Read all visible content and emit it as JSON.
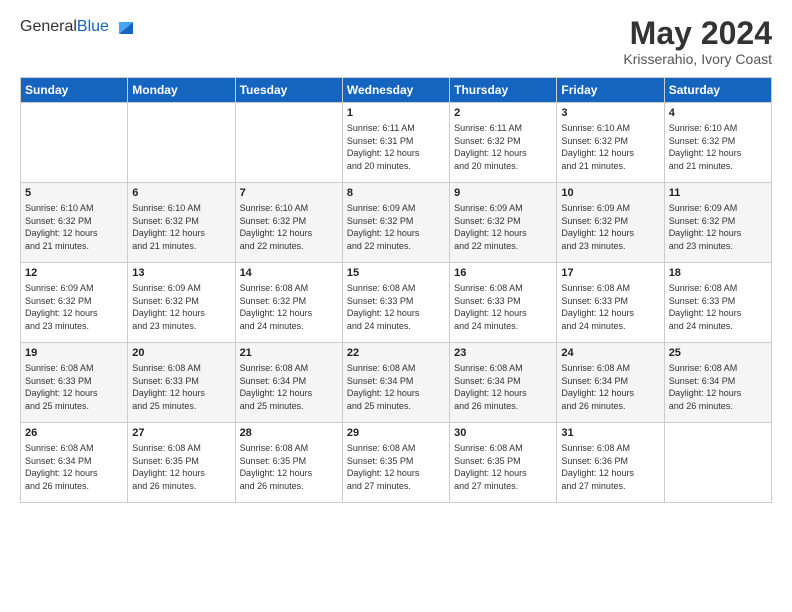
{
  "header": {
    "logo_general": "General",
    "logo_blue": "Blue",
    "month_year": "May 2024",
    "location": "Krisserahio, Ivory Coast"
  },
  "weekdays": [
    "Sunday",
    "Monday",
    "Tuesday",
    "Wednesday",
    "Thursday",
    "Friday",
    "Saturday"
  ],
  "weeks": [
    [
      {
        "day": "",
        "info": ""
      },
      {
        "day": "",
        "info": ""
      },
      {
        "day": "",
        "info": ""
      },
      {
        "day": "1",
        "info": "Sunrise: 6:11 AM\nSunset: 6:31 PM\nDaylight: 12 hours\nand 20 minutes."
      },
      {
        "day": "2",
        "info": "Sunrise: 6:11 AM\nSunset: 6:32 PM\nDaylight: 12 hours\nand 20 minutes."
      },
      {
        "day": "3",
        "info": "Sunrise: 6:10 AM\nSunset: 6:32 PM\nDaylight: 12 hours\nand 21 minutes."
      },
      {
        "day": "4",
        "info": "Sunrise: 6:10 AM\nSunset: 6:32 PM\nDaylight: 12 hours\nand 21 minutes."
      }
    ],
    [
      {
        "day": "5",
        "info": "Sunrise: 6:10 AM\nSunset: 6:32 PM\nDaylight: 12 hours\nand 21 minutes."
      },
      {
        "day": "6",
        "info": "Sunrise: 6:10 AM\nSunset: 6:32 PM\nDaylight: 12 hours\nand 21 minutes."
      },
      {
        "day": "7",
        "info": "Sunrise: 6:10 AM\nSunset: 6:32 PM\nDaylight: 12 hours\nand 22 minutes."
      },
      {
        "day": "8",
        "info": "Sunrise: 6:09 AM\nSunset: 6:32 PM\nDaylight: 12 hours\nand 22 minutes."
      },
      {
        "day": "9",
        "info": "Sunrise: 6:09 AM\nSunset: 6:32 PM\nDaylight: 12 hours\nand 22 minutes."
      },
      {
        "day": "10",
        "info": "Sunrise: 6:09 AM\nSunset: 6:32 PM\nDaylight: 12 hours\nand 23 minutes."
      },
      {
        "day": "11",
        "info": "Sunrise: 6:09 AM\nSunset: 6:32 PM\nDaylight: 12 hours\nand 23 minutes."
      }
    ],
    [
      {
        "day": "12",
        "info": "Sunrise: 6:09 AM\nSunset: 6:32 PM\nDaylight: 12 hours\nand 23 minutes."
      },
      {
        "day": "13",
        "info": "Sunrise: 6:09 AM\nSunset: 6:32 PM\nDaylight: 12 hours\nand 23 minutes."
      },
      {
        "day": "14",
        "info": "Sunrise: 6:08 AM\nSunset: 6:32 PM\nDaylight: 12 hours\nand 24 minutes."
      },
      {
        "day": "15",
        "info": "Sunrise: 6:08 AM\nSunset: 6:33 PM\nDaylight: 12 hours\nand 24 minutes."
      },
      {
        "day": "16",
        "info": "Sunrise: 6:08 AM\nSunset: 6:33 PM\nDaylight: 12 hours\nand 24 minutes."
      },
      {
        "day": "17",
        "info": "Sunrise: 6:08 AM\nSunset: 6:33 PM\nDaylight: 12 hours\nand 24 minutes."
      },
      {
        "day": "18",
        "info": "Sunrise: 6:08 AM\nSunset: 6:33 PM\nDaylight: 12 hours\nand 24 minutes."
      }
    ],
    [
      {
        "day": "19",
        "info": "Sunrise: 6:08 AM\nSunset: 6:33 PM\nDaylight: 12 hours\nand 25 minutes."
      },
      {
        "day": "20",
        "info": "Sunrise: 6:08 AM\nSunset: 6:33 PM\nDaylight: 12 hours\nand 25 minutes."
      },
      {
        "day": "21",
        "info": "Sunrise: 6:08 AM\nSunset: 6:34 PM\nDaylight: 12 hours\nand 25 minutes."
      },
      {
        "day": "22",
        "info": "Sunrise: 6:08 AM\nSunset: 6:34 PM\nDaylight: 12 hours\nand 25 minutes."
      },
      {
        "day": "23",
        "info": "Sunrise: 6:08 AM\nSunset: 6:34 PM\nDaylight: 12 hours\nand 26 minutes."
      },
      {
        "day": "24",
        "info": "Sunrise: 6:08 AM\nSunset: 6:34 PM\nDaylight: 12 hours\nand 26 minutes."
      },
      {
        "day": "25",
        "info": "Sunrise: 6:08 AM\nSunset: 6:34 PM\nDaylight: 12 hours\nand 26 minutes."
      }
    ],
    [
      {
        "day": "26",
        "info": "Sunrise: 6:08 AM\nSunset: 6:34 PM\nDaylight: 12 hours\nand 26 minutes."
      },
      {
        "day": "27",
        "info": "Sunrise: 6:08 AM\nSunset: 6:35 PM\nDaylight: 12 hours\nand 26 minutes."
      },
      {
        "day": "28",
        "info": "Sunrise: 6:08 AM\nSunset: 6:35 PM\nDaylight: 12 hours\nand 26 minutes."
      },
      {
        "day": "29",
        "info": "Sunrise: 6:08 AM\nSunset: 6:35 PM\nDaylight: 12 hours\nand 27 minutes."
      },
      {
        "day": "30",
        "info": "Sunrise: 6:08 AM\nSunset: 6:35 PM\nDaylight: 12 hours\nand 27 minutes."
      },
      {
        "day": "31",
        "info": "Sunrise: 6:08 AM\nSunset: 6:36 PM\nDaylight: 12 hours\nand 27 minutes."
      },
      {
        "day": "",
        "info": ""
      }
    ]
  ]
}
